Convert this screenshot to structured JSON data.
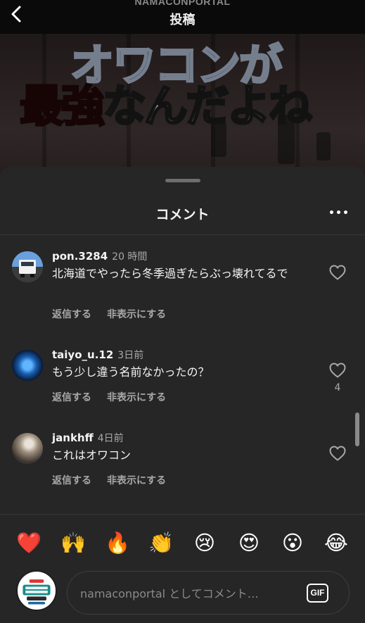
{
  "header": {
    "account_name": "NAMACONPORTAL",
    "title": "投稿",
    "back_icon": "chevron-left-icon"
  },
  "post": {
    "overlay_line1": "オワコンが",
    "overlay_line2_red": "最強",
    "overlay_line2_white": "なんだよね"
  },
  "comment_sheet": {
    "title": "コメント",
    "more_icon": "more-horizontal-icon",
    "comments": [
      {
        "username": "pon.3284",
        "time": "20 時間",
        "text": "北海道でやったら冬季過ぎたらぶっ壊れてるで",
        "reply_label": "返信する",
        "hide_label": "非表示にする",
        "likes": ""
      },
      {
        "username": "taiyo_u.12",
        "time": "3日前",
        "text": "もう少し違う名前なかったの？",
        "reply_label": "返信する",
        "hide_label": "非表示にする",
        "likes": "4"
      },
      {
        "username": "jankhff",
        "time": "4日前",
        "text": "これはオワコン",
        "reply_label": "返信する",
        "hide_label": "非表示にする",
        "likes": ""
      }
    ]
  },
  "emoji_reactions": [
    "❤️",
    "🙌",
    "🔥",
    "👏",
    "😢",
    "😍",
    "😮",
    "😂"
  ],
  "composer": {
    "placeholder": "namaconportal としてコメント…",
    "gif_label": "GIF"
  },
  "colors": {
    "background": "#000000",
    "sheet": "#262626",
    "text_primary": "#f5f5f5",
    "text_secondary": "#a8a8a8"
  }
}
